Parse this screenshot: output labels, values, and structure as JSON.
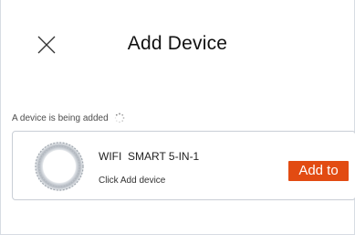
{
  "header": {
    "title": "Add Device",
    "close_icon": "close-icon"
  },
  "status": {
    "text": "A device is being added",
    "icon": "loading-spinner-icon"
  },
  "device": {
    "name": "WIFI  SMART 5-IN-1",
    "subtitle": "Click Add device",
    "image_icon": "device-ring-image",
    "add_label": "Add to",
    "accent_color": "#e24b12"
  }
}
